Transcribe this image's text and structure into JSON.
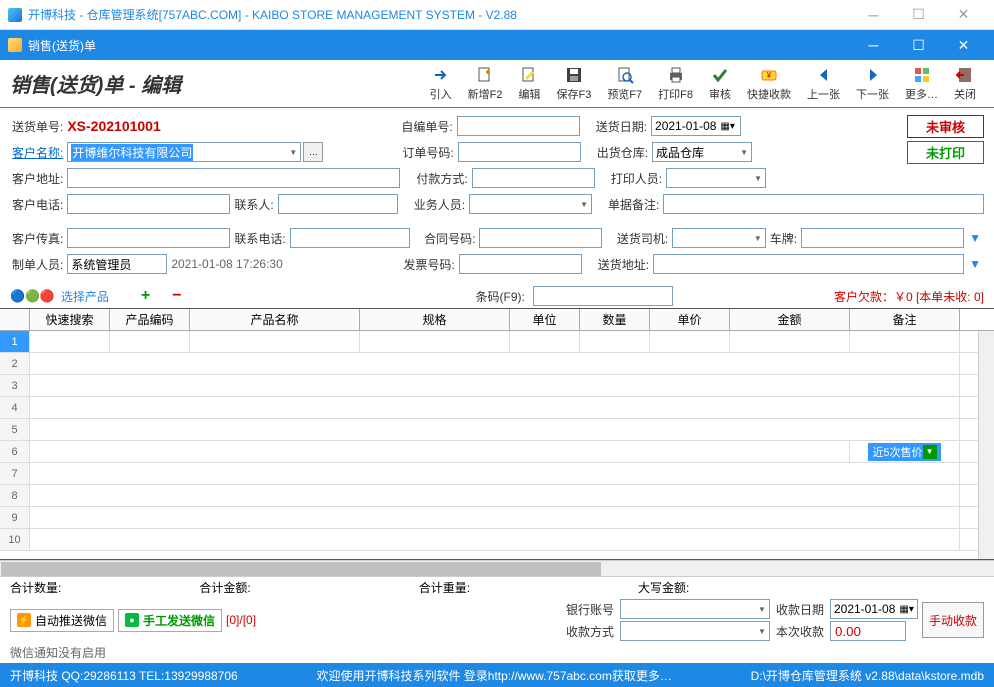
{
  "window": {
    "title": "开博科技 - 仓库管理系统[757ABC.COM] - KAIBO STORE MANAGEMENT SYSTEM - V2.88",
    "subtitle": "销售(送货)单"
  },
  "heading": "销售(送货)单 - 编辑",
  "toolbar": {
    "import": "引入",
    "new": "新增F2",
    "edit": "编辑",
    "save": "保存F3",
    "preview": "预览F7",
    "print": "打印F8",
    "audit": "审核",
    "quickpay": "快捷收款",
    "prev": "上一张",
    "next": "下一张",
    "more": "更多…",
    "close": "关闭"
  },
  "form": {
    "doc_no_label": "送货单号:",
    "doc_no": "XS-202101001",
    "self_no_label": "自编单号:",
    "self_no": "",
    "deliver_date_label": "送货日期:",
    "deliver_date": "2021-01-08",
    "cust_name_label": "客户名称:",
    "cust_name": "开博维尔科技有限公司",
    "order_no_label": "订单号码:",
    "order_no": "",
    "warehouse_label": "出货仓库:",
    "warehouse": "成品仓库",
    "cust_addr_label": "客户地址:",
    "cust_addr": "",
    "pay_method_label": "付款方式:",
    "pay_method": "",
    "printer_label": "打印人员:",
    "printer": "",
    "cust_tel_label": "客户电话:",
    "cust_tel": "",
    "contact_label": "联系人:",
    "contact": "",
    "salesman_label": "业务人员:",
    "salesman": "",
    "remark_label": "单据备注:",
    "remark": "",
    "cust_fax_label": "客户传真:",
    "cust_fax": "",
    "contact_tel_label": "联系电话:",
    "contact_tel": "",
    "contract_label": "合同号码:",
    "contract": "",
    "driver_label": "送货司机:",
    "driver": "",
    "plate_label": "车牌:",
    "plate": "",
    "creator_label": "制单人员:",
    "creator": "系统管理员",
    "create_time": "2021-01-08 17:26:30",
    "invoice_label": "发票号码:",
    "invoice": "",
    "ship_addr_label": "送货地址:",
    "ship_addr": ""
  },
  "status": {
    "not_audited": "未审核",
    "not_printed": "未打印"
  },
  "products": {
    "select_label": "选择产品",
    "barcode_label": "条码(F9):",
    "debt_text": "客户欠款：￥0 [本单未收: 0]",
    "columns": [
      "",
      "快速搜索",
      "产品编码",
      "产品名称",
      "规格",
      "单位",
      "数量",
      "单价",
      "金额",
      "备注"
    ],
    "popup": "近5次售价"
  },
  "totals": {
    "qty_label": "合计数量:",
    "amt_label": "合计金额:",
    "wt_label": "合计重量:",
    "cn_label": "大写金额:"
  },
  "bottom": {
    "auto_push": "自动推送微信",
    "manual_send": "手工发送微信",
    "count": "[0]/[0]",
    "notice": "微信通知没有启用",
    "bank_label": "银行账号",
    "bank": "",
    "recv_date_label": "收款日期",
    "recv_date": "2021-01-08",
    "recv_method_label": "收款方式",
    "recv_method": "",
    "this_recv_label": "本次收款",
    "this_recv": "0.00",
    "manual_recv": "手动收款"
  },
  "statusbar": {
    "left": "开博科技 QQ:29286113 TEL:13929988706",
    "mid": "欢迎使用开博科技系列软件   登录http://www.757abc.com获取更多…",
    "right": "D:\\开博仓库管理系统 v2.88\\data\\kstore.mdb"
  }
}
